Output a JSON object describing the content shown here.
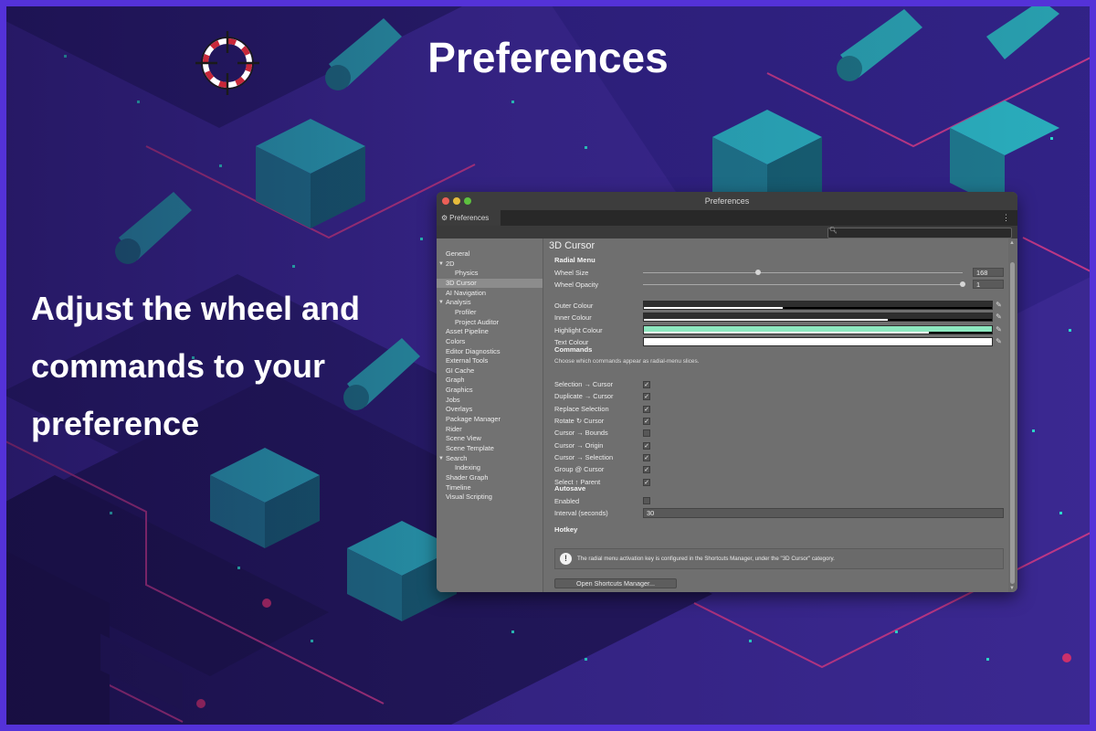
{
  "marketing": {
    "title": "Preferences",
    "tagline": "Adjust the wheel and commands to your preference"
  },
  "window": {
    "title": "Preferences",
    "tab_label": "Preferences",
    "tab_icon": "gear-icon",
    "menu_icon": "⋮",
    "search_placeholder": ""
  },
  "sidebar": {
    "items": [
      {
        "label": "General",
        "indent": 0,
        "foldout": false
      },
      {
        "label": "2D",
        "indent": 0,
        "foldout": true
      },
      {
        "label": "Physics",
        "indent": 1,
        "foldout": false
      },
      {
        "label": "3D Cursor",
        "indent": 0,
        "foldout": false,
        "selected": true
      },
      {
        "label": "AI Navigation",
        "indent": 0,
        "foldout": false
      },
      {
        "label": "Analysis",
        "indent": 0,
        "foldout": true
      },
      {
        "label": "Profiler",
        "indent": 1,
        "foldout": false
      },
      {
        "label": "Project Auditor",
        "indent": 1,
        "foldout": false
      },
      {
        "label": "Asset Pipeline",
        "indent": 0,
        "foldout": false
      },
      {
        "label": "Colors",
        "indent": 0,
        "foldout": false
      },
      {
        "label": "Editor Diagnostics",
        "indent": 0,
        "foldout": false
      },
      {
        "label": "External Tools",
        "indent": 0,
        "foldout": false
      },
      {
        "label": "GI Cache",
        "indent": 0,
        "foldout": false
      },
      {
        "label": "Graph",
        "indent": 0,
        "foldout": false
      },
      {
        "label": "Graphics",
        "indent": 0,
        "foldout": false
      },
      {
        "label": "Jobs",
        "indent": 0,
        "foldout": false
      },
      {
        "label": "Overlays",
        "indent": 0,
        "foldout": false
      },
      {
        "label": "Package Manager",
        "indent": 0,
        "foldout": false
      },
      {
        "label": "Rider",
        "indent": 0,
        "foldout": false
      },
      {
        "label": "Scene View",
        "indent": 0,
        "foldout": false
      },
      {
        "label": "Scene Template",
        "indent": 0,
        "foldout": false
      },
      {
        "label": "Search",
        "indent": 0,
        "foldout": true
      },
      {
        "label": "Indexing",
        "indent": 1,
        "foldout": false
      },
      {
        "label": "Shader Graph",
        "indent": 0,
        "foldout": false
      },
      {
        "label": "Timeline",
        "indent": 0,
        "foldout": false
      },
      {
        "label": "Visual Scripting",
        "indent": 0,
        "foldout": false
      }
    ]
  },
  "content": {
    "heading": "3D Cursor",
    "radial_menu": {
      "section": "Radial Menu",
      "wheel_size_label": "Wheel Size",
      "wheel_size_value": "168",
      "wheel_size_fraction": 0.36,
      "wheel_opacity_label": "Wheel Opacity",
      "wheel_opacity_value": "1",
      "wheel_opacity_fraction": 1.0,
      "colours": [
        {
          "label": "Outer Colour",
          "color": "#2e2e2e",
          "alpha": 0.4
        },
        {
          "label": "Inner Colour",
          "color": "#2e2e2e",
          "alpha": 0.7
        },
        {
          "label": "Highlight Colour",
          "color": "#8ee8c0",
          "alpha": 0.82
        },
        {
          "label": "Text Colour",
          "color": "#ffffff",
          "alpha": 1.0
        }
      ]
    },
    "commands": {
      "section": "Commands",
      "hint": "Choose which commands appear as radial-menu slices.",
      "items": [
        {
          "label": "Selection → Cursor",
          "checked": true
        },
        {
          "label": "Duplicate → Cursor",
          "checked": true
        },
        {
          "label": "Replace Selection",
          "checked": true
        },
        {
          "label": "Rotate ↻ Cursor",
          "checked": true
        },
        {
          "label": "Cursor → Bounds",
          "checked": false
        },
        {
          "label": "Cursor → Origin",
          "checked": true
        },
        {
          "label": "Cursor → Selection",
          "checked": true
        },
        {
          "label": "Group @ Cursor",
          "checked": true
        },
        {
          "label": "Select ↑ Parent",
          "checked": true
        }
      ]
    },
    "autosave": {
      "section": "Autosave",
      "enabled_label": "Enabled",
      "enabled": false,
      "interval_label": "Interval (seconds)",
      "interval_value": "30"
    },
    "hotkey": {
      "section": "Hotkey",
      "info": "The radial menu activation key is configured in the Shortcuts Manager, under the \"3D Cursor\" category.",
      "button": "Open Shortcuts Manager..."
    }
  },
  "colors": {
    "background": "#3d2a96",
    "frame": "#5432d8",
    "teal": "#2bb7c4",
    "magenta": "#c83a8a",
    "window_bg": "#6f6f6f"
  }
}
